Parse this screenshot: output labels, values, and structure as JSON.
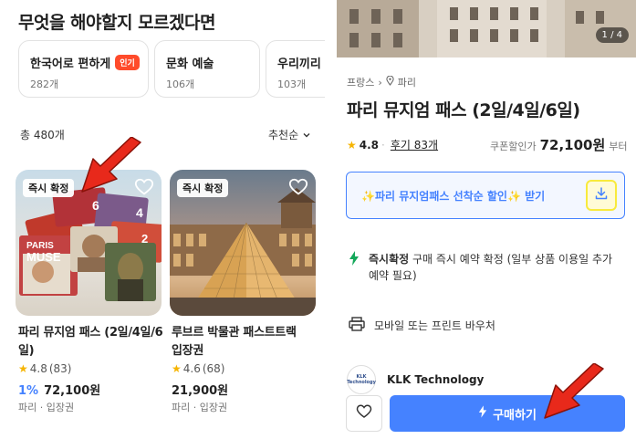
{
  "left": {
    "heading": "무엇을 해야할지 모르겠다면",
    "categories": [
      {
        "name": "한국어로 편하게",
        "badge": "인기",
        "count": "282개"
      },
      {
        "name": "문화 예술",
        "count": "106개"
      },
      {
        "name": "우리끼리",
        "count": "103개"
      }
    ],
    "total": "총 480개",
    "sort": "추천순",
    "cards": [
      {
        "tag": "즉시 확정",
        "title": "파리 뮤지엄 패스 (2일/4일/6일)",
        "rating": "4.8",
        "reviews": "(83)",
        "discount": "1%",
        "price": "72,100원",
        "location": "파리 · 입장권",
        "image_text": {
          "a": "PARIS",
          "b": "MUSE",
          "c": "6",
          "d": "4",
          "e": "2"
        }
      },
      {
        "tag": "즉시 확정",
        "title": "루브르 박물관 패스트트랙 입장권",
        "rating": "4.6",
        "reviews": "(68)",
        "price": "21,900원",
        "location": "파리 · 입장권"
      }
    ]
  },
  "right": {
    "page_indicator": "1 / 4",
    "breadcrumb": {
      "country": "프랑스",
      "city": "파리"
    },
    "title": "파리 뮤지엄 패스 (2일/4일/6일)",
    "rating": "4.8",
    "reviews_link": "후기 83개",
    "coupon_label": "쿠폰할인가",
    "coupon_price": "72,100원",
    "from": "부터",
    "coupon_banner": "✨파리 뮤지엄패스 선착순 할인✨ 받기",
    "instant_title": "즉시확정",
    "instant_desc": "구매 즉시 예약 확정 (일부 상품 이용일 추가 예약 필요)",
    "voucher": "모바일 또는 프린트 바우처",
    "vendor": "KLK Technology",
    "vendor_logo": "KLK Technology",
    "buy": "구매하기"
  },
  "colors": {
    "accent": "#4582ff",
    "hot": "#ff4b2b",
    "highlight": "#f8ea3c",
    "arrow": "#e8291b",
    "instant": "#14a85a"
  },
  "icons": [
    "heart-outline-icon",
    "chevron-down-icon",
    "star-icon",
    "location-pin-icon",
    "download-icon",
    "lightning-icon",
    "printer-icon",
    "heart-icon",
    "arrow-pointer-icon"
  ]
}
